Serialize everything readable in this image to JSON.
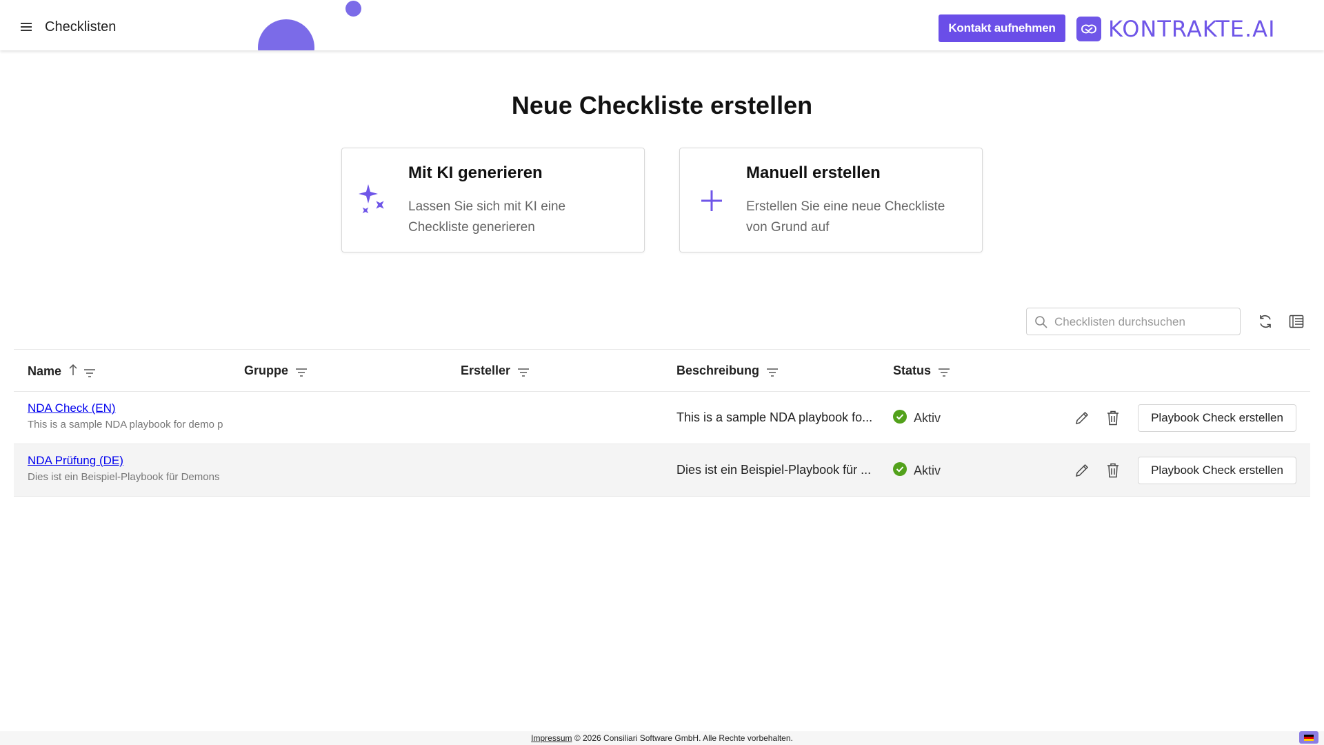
{
  "header": {
    "title": "Checklisten",
    "contact_label": "Kontakt aufnehmen",
    "logo_text": "KONTRAKTE.AI"
  },
  "main": {
    "heading": "Neue Checkliste erstellen",
    "cards": [
      {
        "title": "Mit KI generieren",
        "description": "Lassen Sie sich mit KI eine Checkliste generieren",
        "icon": "sparkles-icon"
      },
      {
        "title": "Manuell erstellen",
        "description": "Erstellen Sie eine neue Checkliste von Grund auf",
        "icon": "plus-icon"
      }
    ]
  },
  "toolbar": {
    "search_placeholder": "Checklisten durchsuchen",
    "search_value": ""
  },
  "table": {
    "columns": [
      "Name",
      "Gruppe",
      "Ersteller",
      "Beschreibung",
      "Status"
    ],
    "sort": {
      "column": "Name",
      "direction": "ascending"
    },
    "rows": [
      {
        "name": "NDA Check (EN)",
        "subtitle": "This is a sample NDA playbook for demo p",
        "group": "",
        "creator": "",
        "description": "This is a sample NDA playbook fo...",
        "status": "Aktiv",
        "action_label": "Playbook Check erstellen"
      },
      {
        "name": "NDA Prüfung (DE)",
        "subtitle": "Dies ist ein Beispiel-Playbook für Demons",
        "group": "",
        "creator": "",
        "description": "Dies ist ein Beispiel-Playbook für ...",
        "status": "Aktiv",
        "action_label": "Playbook Check erstellen"
      }
    ]
  },
  "footer": {
    "impressum": "Impressum",
    "copyright": " © 2026 Consiliari Software GmbH. Alle Rechte vorbehalten."
  },
  "colors": {
    "accent": "#6a4ee8",
    "status_active": "#52a11b",
    "link": "#0000ee"
  }
}
